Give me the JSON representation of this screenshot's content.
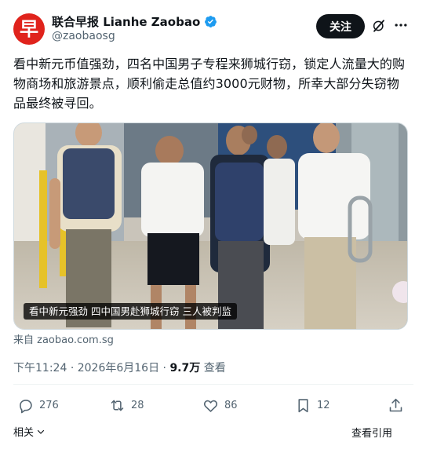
{
  "account": {
    "avatar_char": "早",
    "display_name": "联合早报 Lianhe Zaobao",
    "handle": "@zaobaosg",
    "follow_label": "关注"
  },
  "tweet": {
    "text": "看中新元币值强劲，四名中国男子专程来狮城行窃，锁定人流量大的购物商场和旅游景点，顺利偷走总值约3000元财物，所幸大部分失窃物品最终被寻回。",
    "media_caption": "看中新元强劲 四中国男赴狮城行窃 三人被判监",
    "source": "来自 zaobao.com.sg",
    "time": "下午11:24",
    "date": "2026年6月16日",
    "views_count": "9.7万",
    "views_label": "查看"
  },
  "actions": {
    "replies": "276",
    "reposts": "28",
    "likes": "86",
    "bookmarks": "12"
  },
  "footer": {
    "related_label": "相关",
    "more_replies_label": "查看引用"
  },
  "colors": {
    "brand_red": "#e0231c",
    "verified_blue": "#1d9bf0",
    "text_primary": "#0f1419",
    "text_secondary": "#536471"
  },
  "icons": [
    "verified-badge-icon",
    "grok-icon",
    "more-icon",
    "reply-icon",
    "repost-icon",
    "like-icon",
    "bookmark-icon",
    "share-icon",
    "chevron-down-icon"
  ]
}
